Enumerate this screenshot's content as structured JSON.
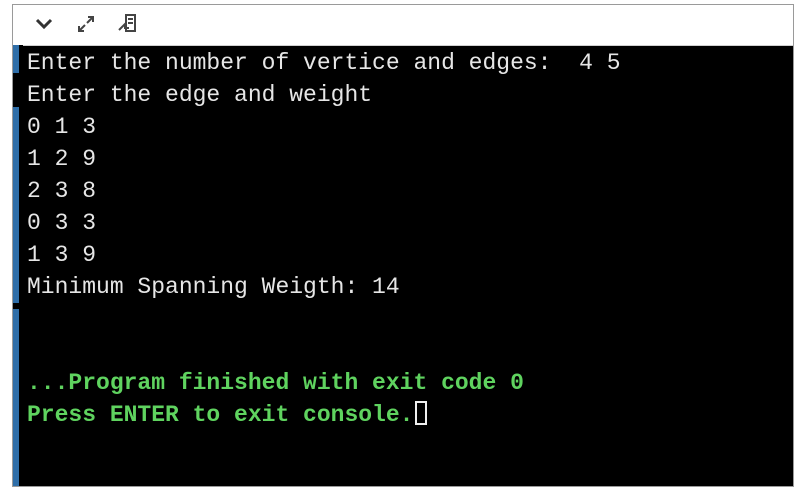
{
  "toolbar": {
    "icons": [
      "chevron-down-icon",
      "expand-icon",
      "share-icon"
    ]
  },
  "console": {
    "lines": [
      {
        "text": "Enter the number of vertice and edges:  4 5",
        "style": "out"
      },
      {
        "text": "Enter the edge and weight",
        "style": "out"
      },
      {
        "text": "0 1 3",
        "style": "out"
      },
      {
        "text": "1 2 9",
        "style": "out"
      },
      {
        "text": "2 3 8",
        "style": "out"
      },
      {
        "text": "0 3 3",
        "style": "out"
      },
      {
        "text": "1 3 9",
        "style": "out"
      },
      {
        "text": "Minimum Spanning Weigth: 14",
        "style": "out"
      },
      {
        "text": "",
        "style": "out"
      },
      {
        "text": "",
        "style": "out"
      },
      {
        "text": "...Program finished with exit code 0",
        "style": "green"
      },
      {
        "text": "Press ENTER to exit console.",
        "style": "green"
      }
    ]
  },
  "colors": {
    "background": "#000000",
    "text": "#e6e6e6",
    "success": "#5fd35f",
    "gutter": "#2f6ea8"
  }
}
